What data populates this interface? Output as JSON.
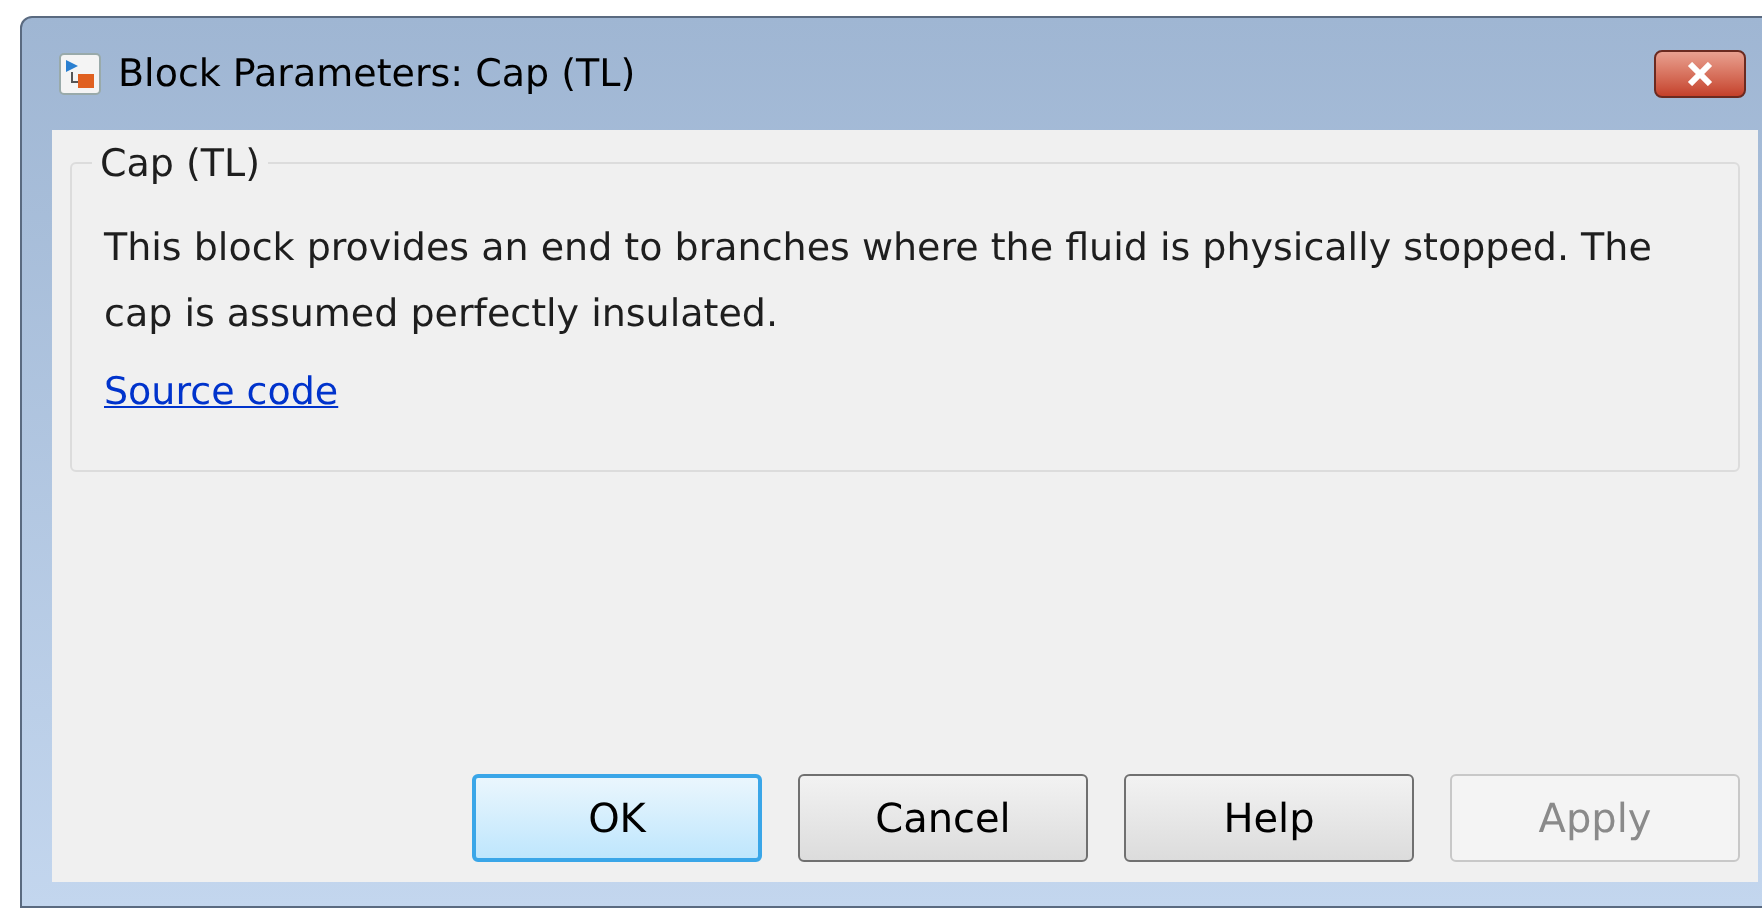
{
  "window": {
    "title": "Block Parameters: Cap (TL)"
  },
  "group": {
    "title": "Cap (TL)",
    "description": "This block provides an end to branches where the fluid is physically stopped. The cap is assumed perfectly insulated.",
    "link": "Source code"
  },
  "buttons": [
    {
      "label": "OK",
      "default": true,
      "disabled": false
    },
    {
      "label": "Cancel",
      "default": false,
      "disabled": false
    },
    {
      "label": "Help",
      "default": false,
      "disabled": false
    },
    {
      "label": "Apply",
      "default": false,
      "disabled": true
    }
  ]
}
